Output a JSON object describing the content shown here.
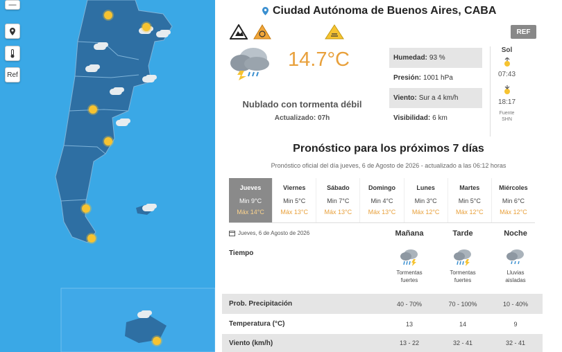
{
  "map": {
    "controls": {
      "zoom_minus": "—",
      "ref": "Ref"
    }
  },
  "header": {
    "location": "Ciudad Autónoma de Buenos Aires, CABA",
    "ref_button": "REF"
  },
  "current": {
    "temperature": "14.7°C",
    "condition": "Nublado con tormenta débil",
    "updated": "Actualizado: 07h",
    "stats": [
      {
        "label": "Humedad:",
        "value": "93 %"
      },
      {
        "label": "Presión:",
        "value": "1001 hPa"
      },
      {
        "label": "Viento:",
        "value": "Sur a 4 km/h"
      },
      {
        "label": "Visibilidad:",
        "value": "6 km"
      }
    ],
    "sun": {
      "title": "Sol",
      "sunrise": "07:43",
      "sunset": "18:17",
      "source_line1": "Fuente",
      "source_line2": "SHN"
    }
  },
  "forecast": {
    "title": "Pronóstico para los próximos 7 días",
    "subtitle": "Pronóstico oficial del día jueves, 6 de Agosto de 2026 - actualizado a las 06:12 horas",
    "days": [
      {
        "name": "Jueves",
        "min": "Min 9°C",
        "max": "Máx 14°C"
      },
      {
        "name": "Viernes",
        "min": "Min 5°C",
        "max": "Máx 13°C"
      },
      {
        "name": "Sábado",
        "min": "Min 7°C",
        "max": "Máx 13°C"
      },
      {
        "name": "Domingo",
        "min": "Min 4°C",
        "max": "Máx 13°C"
      },
      {
        "name": "Lunes",
        "min": "Min 3°C",
        "max": "Máx 12°C"
      },
      {
        "name": "Martes",
        "min": "Min 5°C",
        "max": "Máx 12°C"
      },
      {
        "name": "Miércoles",
        "min": "Min 6°C",
        "max": "Máx 12°C"
      }
    ],
    "detail": {
      "date": "Jueves, 6 de Agosto de 2026",
      "periods": [
        "Mañana",
        "Tarde",
        "Noche"
      ],
      "tiempo_label": "Tiempo",
      "tiempo": [
        {
          "line1": "Tormentas",
          "line2": "fuertes"
        },
        {
          "line1": "Tormentas",
          "line2": "fuertes"
        },
        {
          "line1": "Lluvias",
          "line2": "aisladas"
        }
      ],
      "rows": [
        {
          "label": "Prob. Precipitación",
          "values": [
            "40 - 70%",
            "70 - 100%",
            "10 - 40%"
          ]
        },
        {
          "label": "Temperatura (°C)",
          "values": [
            "13",
            "14",
            "9"
          ]
        },
        {
          "label": "Viento (km/h)",
          "values": [
            "13 - 22",
            "32 - 41",
            "32 - 41"
          ]
        }
      ]
    }
  },
  "colors": {
    "accent": "#e8a03b",
    "map_water": "#3aa8e6",
    "map_land": "#2e6fa3"
  }
}
